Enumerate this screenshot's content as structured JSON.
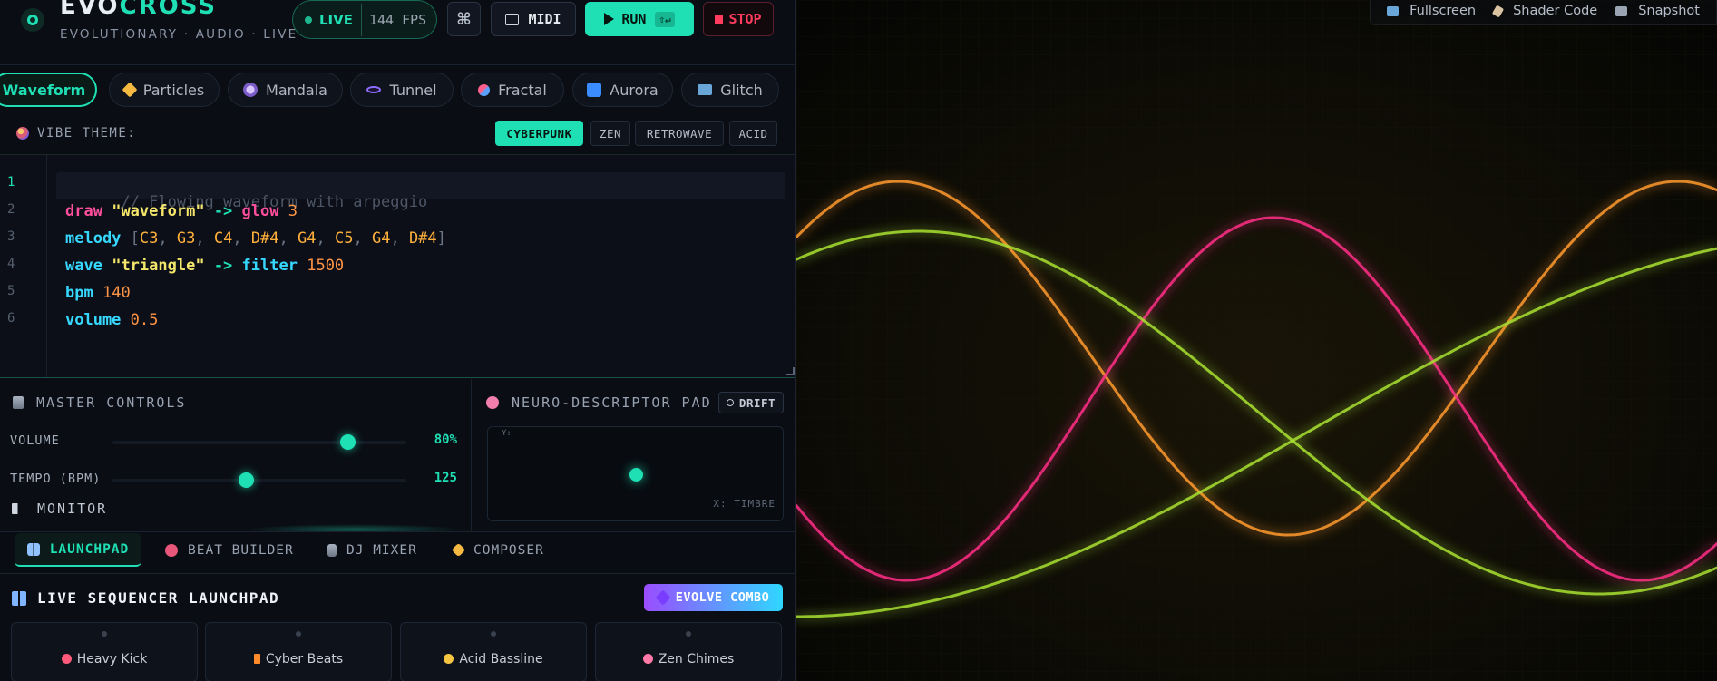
{
  "app": {
    "title_main": "EVO",
    "title_accent": "CROSS",
    "subtitle": "EVOLUTIONARY · AUDIO · LIVE"
  },
  "status": {
    "live_label": "LIVE",
    "fps_label": "144 FPS"
  },
  "header_buttons": {
    "cmd_glyph": "⌘",
    "midi_label": "MIDI",
    "run_label": "RUN",
    "run_shortcut": "⇧↵",
    "stop_label": "STOP"
  },
  "visual_tabs": [
    {
      "label": "Waveform",
      "icon": "wave-icon",
      "active": true
    },
    {
      "label": "Particles",
      "icon": "sparkles-icon"
    },
    {
      "label": "Mandala",
      "icon": "crystal-ball-icon"
    },
    {
      "label": "Tunnel",
      "icon": "hole-icon"
    },
    {
      "label": "Fractal",
      "icon": "dna-icon"
    },
    {
      "label": "Aurora",
      "icon": "ocean-wave-icon"
    },
    {
      "label": "Glitch",
      "icon": "tv-icon"
    }
  ],
  "vibe": {
    "label": "VIBE THEME:",
    "themes": [
      "CYBERPUNK",
      "ZEN",
      "RETROWAVE",
      "ACID"
    ],
    "active": "CYBERPUNK"
  },
  "editor": {
    "line_numbers": [
      "1",
      "2",
      "3",
      "4",
      "5",
      "6"
    ],
    "active_line": 1,
    "l1_comment": "// Flowing waveform with arpeggio",
    "l2_kw": "draw",
    "l2_str": "\"waveform\"",
    "l2_arrow": "->",
    "l2_fn": "glow",
    "l2_num": "3",
    "l3_kw": "melody",
    "l3_open": "[",
    "l3_notes": [
      "C3",
      "G3",
      "C4",
      "D#4",
      "G4",
      "C5",
      "G4",
      "D#4"
    ],
    "l3_close": "]",
    "l4_kw": "wave",
    "l4_str": "\"triangle\"",
    "l4_arrow": "->",
    "l4_fn": "filter",
    "l4_num": "1500",
    "l5_kw": "bpm",
    "l5_num": "140",
    "l6_kw": "volume",
    "l6_num": "0.5"
  },
  "master": {
    "title": "MASTER CONTROLS",
    "volume_label": "VOLUME",
    "volume_value": "80%",
    "volume_level": 0.8,
    "tempo_label": "TEMPO (BPM)",
    "tempo_value": "125",
    "tempo_level": 0.455,
    "monitor_title": "MONITOR"
  },
  "neuro": {
    "title": "NEURO-DESCRIPTOR PAD",
    "drift_label": "DRIFT",
    "y_axis": "Y:",
    "x_axis": "X: TIMBRE",
    "x_value": 0.5,
    "y_value": 0.5
  },
  "bottom_tabs": [
    {
      "label": "LAUNCHPAD",
      "icon": "grid-icon",
      "active": true
    },
    {
      "label": "BEAT BUILDER",
      "icon": "demon-icon"
    },
    {
      "label": "DJ MIXER",
      "icon": "sliders-icon"
    },
    {
      "label": "COMPOSER",
      "icon": "sparkles-icon"
    }
  ],
  "launchpad": {
    "title": "LIVE SEQUENCER LAUNCHPAD",
    "evolve_label": "EVOLVE COMBO",
    "pads": [
      {
        "label": "Heavy Kick",
        "icon": "demon-icon",
        "color": "#ff5a7a"
      },
      {
        "label": "Cyber Beats",
        "icon": "lightning-icon",
        "color": "#ff8a2a"
      },
      {
        "label": "Acid Bassline",
        "icon": "dizzy-face-icon",
        "color": "#f5c542"
      },
      {
        "label": "Zen Chimes",
        "icon": "blossom-icon",
        "color": "#ff7aa8"
      }
    ]
  },
  "canvas_toolbar": {
    "fullscreen_label": "Fullscreen",
    "shader_label": "Shader Code",
    "snapshot_label": "Snapshot"
  },
  "colors": {
    "accent": "#1fe0b4",
    "stop": "#ff3c5e",
    "wave_orange": "#ff9a2e",
    "wave_pink": "#ff2f86",
    "wave_lime": "#a8e032"
  }
}
